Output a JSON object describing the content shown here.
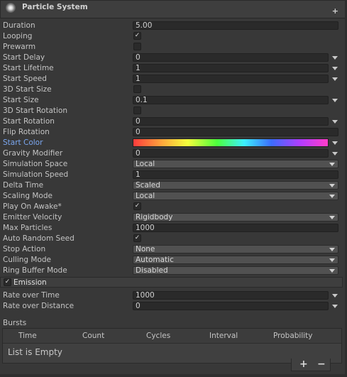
{
  "header": {
    "title": "Particle System",
    "add_label": "+"
  },
  "props": {
    "duration": {
      "label": "Duration",
      "value": "5.00"
    },
    "looping": {
      "label": "Looping",
      "mark": "✓"
    },
    "prewarm": {
      "label": "Prewarm",
      "mark": ""
    },
    "start_delay": {
      "label": "Start Delay",
      "value": "0"
    },
    "start_lifetime": {
      "label": "Start Lifetime",
      "value": "1"
    },
    "start_speed": {
      "label": "Start Speed",
      "value": "1"
    },
    "start_size_3d": {
      "label": "3D Start Size",
      "mark": ""
    },
    "start_size": {
      "label": "Start Size",
      "value": "0.1"
    },
    "start_rotation_3d": {
      "label": "3D Start Rotation",
      "mark": ""
    },
    "start_rotation": {
      "label": "Start Rotation",
      "value": "0"
    },
    "flip_rotation": {
      "label": "Flip Rotation",
      "value": "0"
    },
    "start_color": {
      "label": "Start Color",
      "label_color": "#7ba7f0"
    },
    "gravity_modifier": {
      "label": "Gravity Modifier",
      "value": "0"
    },
    "simulation_space": {
      "label": "Simulation Space",
      "value": "Local"
    },
    "simulation_speed": {
      "label": "Simulation Speed",
      "value": "1"
    },
    "delta_time": {
      "label": "Delta Time",
      "value": "Scaled"
    },
    "scaling_mode": {
      "label": "Scaling Mode",
      "value": "Local"
    },
    "play_on_awake": {
      "label": "Play On Awake*",
      "mark": "✓"
    },
    "emitter_velocity": {
      "label": "Emitter Velocity",
      "value": "Rigidbody"
    },
    "max_particles": {
      "label": "Max Particles",
      "value": "1000"
    },
    "auto_random_seed": {
      "label": "Auto Random Seed",
      "mark": "✓"
    },
    "stop_action": {
      "label": "Stop Action",
      "value": "None"
    },
    "culling_mode": {
      "label": "Culling Mode",
      "value": "Automatic"
    },
    "ring_buffer_mode": {
      "label": "Ring Buffer Mode",
      "value": "Disabled"
    }
  },
  "emission": {
    "title": "Emission",
    "mark": "✓",
    "rate_over_time": {
      "label": "Rate over Time",
      "value": "1000"
    },
    "rate_over_distance": {
      "label": "Rate over Distance",
      "value": "0"
    },
    "bursts": {
      "title": "Bursts",
      "columns": [
        "Time",
        "Count",
        "Cycles",
        "Interval",
        "Probability"
      ],
      "empty_text": "List is Empty",
      "add_label": "+",
      "remove_label": "−"
    }
  },
  "colors": {
    "accent": "#7ba7f0",
    "background": "#383838",
    "field": "#2a2a2a"
  },
  "icons": [
    "particle-system-icon",
    "checkmark-icon",
    "dropdown-arrow-icon",
    "plus-icon",
    "minus-icon"
  ]
}
